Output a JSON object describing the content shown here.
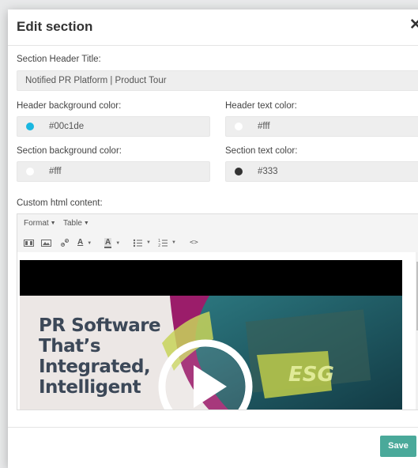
{
  "modal": {
    "title": "Edit section",
    "close_icon": "close-icon"
  },
  "form": {
    "section_header_title": {
      "label": "Section Header Title:",
      "value": "Notified PR Platform | Product Tour"
    },
    "header_bg_color": {
      "label": "Header background color:",
      "value": "#00c1de",
      "swatch": "#1ab7e0"
    },
    "header_text_color": {
      "label": "Header text color:",
      "value": "#fff",
      "swatch": "#ffffff"
    },
    "section_bg_color": {
      "label": "Section background color:",
      "value": "#fff",
      "swatch": "#ffffff"
    },
    "section_text_color": {
      "label": "Section text color:",
      "value": "#333",
      "swatch": "#333333"
    },
    "custom_html": {
      "label": "Custom html content:"
    }
  },
  "editor": {
    "menus": [
      {
        "label": "Format"
      },
      {
        "label": "Table"
      }
    ],
    "toolbar": [
      {
        "name": "media-icon"
      },
      {
        "name": "image-icon"
      },
      {
        "name": "link-icon"
      },
      {
        "name": "text-color-icon",
        "glyph": "A"
      },
      {
        "name": "background-color-icon",
        "glyph": "A"
      },
      {
        "name": "bullet-list-icon"
      },
      {
        "name": "numbered-list-icon"
      },
      {
        "name": "source-code-icon",
        "glyph": "<>"
      }
    ],
    "video": {
      "headline_lines": "PR Software\nThat’s\nIntegrated,\nIntelligent",
      "overlay_text": "ESG",
      "play_icon": "play-icon"
    }
  },
  "footer": {
    "save_label": "Save"
  },
  "colors": {
    "accent": "#4aa99a",
    "headline": "#3c4858",
    "overlay_green": "#c8d35a",
    "magenta": "#9b1d6a",
    "teal": "#1e5560"
  }
}
